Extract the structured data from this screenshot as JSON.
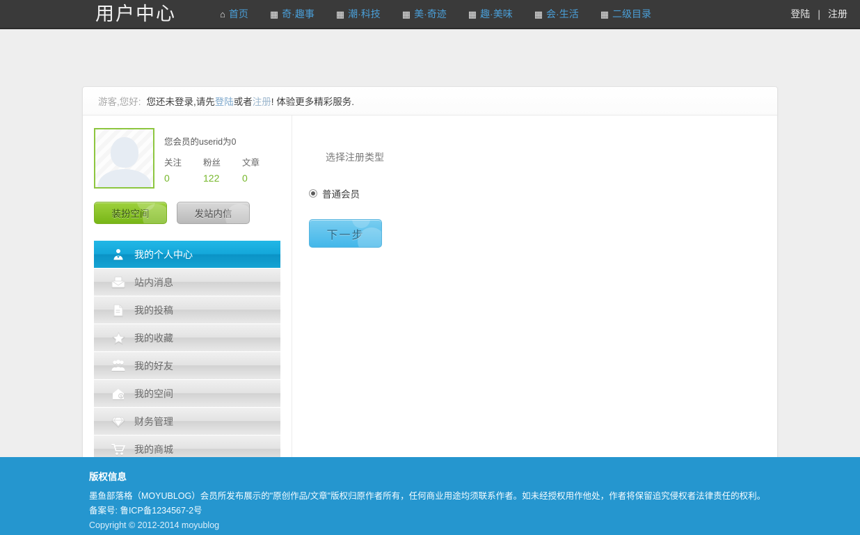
{
  "header": {
    "brand": "用户中心",
    "nav": [
      {
        "icon": "home-icon",
        "glyph": "⌂",
        "label": "首页"
      },
      {
        "icon": "grid-icon",
        "glyph": "▦",
        "label": "奇·趣事"
      },
      {
        "icon": "grid-icon",
        "glyph": "▦",
        "label": "潮·科技"
      },
      {
        "icon": "grid-icon",
        "glyph": "▦",
        "label": "美·奇迹"
      },
      {
        "icon": "grid-icon",
        "glyph": "▦",
        "label": "趣·美味"
      },
      {
        "icon": "grid-icon",
        "glyph": "▦",
        "label": "会·生活"
      },
      {
        "icon": "grid-icon",
        "glyph": "▦",
        "label": "二级目录"
      }
    ],
    "auth": {
      "login": "登陆",
      "separator": "❘",
      "register": "注册"
    }
  },
  "notice": {
    "greeting": "游客,您好:",
    "message_a": "您还未登录,请先",
    "login_link": "登陆",
    "middle": " 或者 ",
    "register_link": "注册",
    "message_b": "! 体验更多精彩服务."
  },
  "profile": {
    "avatar_alt": "avatar-placeholder",
    "userid_text": "您会员的userid为0",
    "stats": [
      {
        "label": "关注",
        "value": "0"
      },
      {
        "label": "粉丝",
        "value": "122"
      },
      {
        "label": "文章",
        "value": "0"
      }
    ],
    "decorate_button": "装扮空间",
    "message_button": "发站内信"
  },
  "sidebar": {
    "items": [
      {
        "icon": "user-profile-icon",
        "label": "我的个人中心",
        "active": true
      },
      {
        "icon": "mail-icon",
        "label": "站内消息",
        "active": false
      },
      {
        "icon": "document-icon",
        "label": "我的投稿",
        "active": false
      },
      {
        "icon": "star-icon",
        "label": "我的收藏",
        "active": false
      },
      {
        "icon": "friends-icon",
        "label": "我的好友",
        "active": false
      },
      {
        "icon": "house-icon",
        "label": "我的空间",
        "active": false
      },
      {
        "icon": "diamond-icon",
        "label": "财务管理",
        "active": false
      },
      {
        "icon": "cart-icon",
        "label": "我的商城",
        "active": false
      }
    ]
  },
  "main": {
    "section_title": "选择注册类型",
    "radio_label": "普通会员",
    "radio_checked": true,
    "next_button": "下一步"
  },
  "footer": {
    "title": "版权信息",
    "line1": "墨鱼部落格（MOYUBLOG）会员所发布展示的\"原创作品/文章\"版权归原作者所有，任何商业用途均须联系作者。如未经授权用作他处，作者将保留追究侵权者法律责任的权利。",
    "line2": "备案号: 鲁ICP备1234567-2号",
    "line3": "Copyright © 2012-2014 moyublog"
  },
  "colors": {
    "header_bg": "#3a3a3a",
    "nav_link": "#4a9fd8",
    "accent_green": "#8dc63f",
    "accent_blue": "#14a7da",
    "footer_bg": "#2596cf",
    "stat_value": "#76b72a"
  }
}
